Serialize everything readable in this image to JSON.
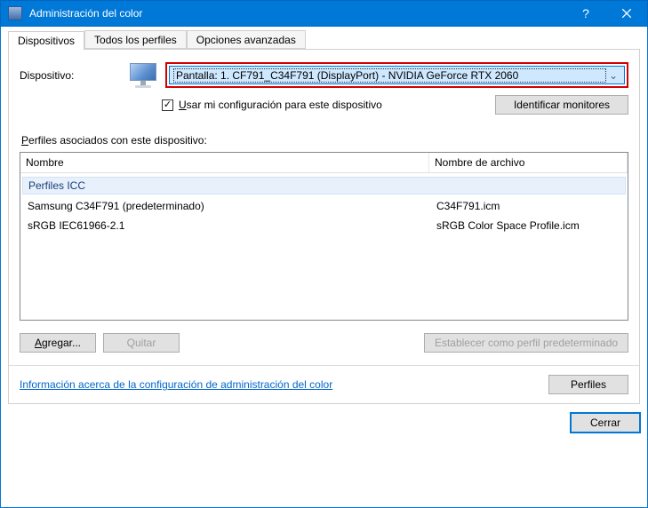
{
  "window": {
    "title": "Administración del color",
    "help_glyph": "?",
    "close_label": "Close"
  },
  "tabs": {
    "devices": "Dispositivos",
    "all_profiles": "Todos los perfiles",
    "advanced": "Opciones avanzadas"
  },
  "device_row": {
    "label": "Dispositivo:",
    "dropdown_value": "Pantalla: 1. CF791_C34F791 (DisplayPort) - NVIDIA GeForce RTX 2060",
    "checkbox_label": "Usar mi configuración para este dispositivo",
    "identify_button": "Identificar monitores"
  },
  "profiles": {
    "caption": "Perfiles asociados con este dispositivo:",
    "col_name": "Nombre",
    "col_file": "Nombre de archivo",
    "group": "Perfiles ICC",
    "rows": [
      {
        "name": "Samsung C34F791 (predeterminado)",
        "file": "C34F791.icm"
      },
      {
        "name": "sRGB IEC61966-2.1",
        "file": "sRGB Color Space Profile.icm"
      }
    ]
  },
  "buttons": {
    "add": "Agregar...",
    "remove": "Quitar",
    "set_default": "Establecer como perfil predeterminado",
    "profiles_btn": "Perfiles",
    "close": "Cerrar"
  },
  "link": {
    "text": "Información acerca de la configuración de administración del color"
  }
}
